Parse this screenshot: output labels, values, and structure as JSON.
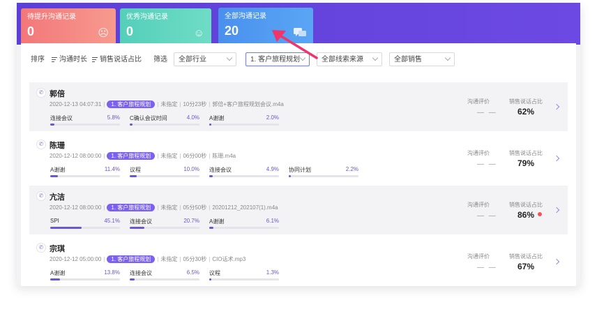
{
  "stats": [
    {
      "label": "待提升沟通记录",
      "value": "0",
      "deco": "⌒"
    },
    {
      "label": "优秀沟通记录",
      "value": "0",
      "deco": "◡"
    },
    {
      "label": "全部沟通记录",
      "value": "20",
      "deco": "▰"
    }
  ],
  "filter": {
    "sort_label": "排序",
    "sort_duration": "沟通时长",
    "sort_ratio": "销售说话占比",
    "filter_label": "筛选",
    "industry": "全部行业",
    "journey": "1. 客户旅程规划",
    "source": "全部线索来源",
    "sales": "全部销售"
  },
  "columns": {
    "eval": "沟通评价",
    "ratio": "销售说话占比"
  },
  "records": [
    {
      "name": "郭倍",
      "time": "2020-12-13 04:07:31",
      "tag": "1. 客户旅程规划",
      "assign": "未指定",
      "duration": "10分23秒",
      "file": "郭倍+客户旅程规划会议.m4a",
      "keywords": [
        {
          "label": "连接会议",
          "value": "5.8%",
          "pct": 5.8
        },
        {
          "label": "C确认会议时间",
          "value": "4.0%",
          "pct": 4.0
        },
        {
          "label": "A谢谢",
          "value": "2.0%",
          "pct": 2.0
        }
      ],
      "eval": "— —",
      "ratio": "62%",
      "alert": false
    },
    {
      "name": "陈珊",
      "time": "2020-12-12 08:00:00",
      "tag": "1. 客户旅程规划",
      "assign": "未指定",
      "duration": "06分00秒",
      "file": "陈珊.m4a",
      "keywords": [
        {
          "label": "A谢谢",
          "value": "11.4%",
          "pct": 11.4
        },
        {
          "label": "议程",
          "value": "10.0%",
          "pct": 10.0
        },
        {
          "label": "连接会议",
          "value": "4.9%",
          "pct": 4.9
        },
        {
          "label": "协同计划",
          "value": "2.2%",
          "pct": 2.2
        }
      ],
      "eval": "— —",
      "ratio": "79%",
      "alert": false
    },
    {
      "name": "亢洁",
      "time": "2020-12-12 08:00:00",
      "tag": "1. 客户旅程规划",
      "assign": "未指定",
      "duration": "05分50秒",
      "file": "20201212_202107(1).m4a",
      "keywords": [
        {
          "label": "SPI",
          "value": "45.1%",
          "pct": 45.1
        },
        {
          "label": "连接会议",
          "value": "20.7%",
          "pct": 20.7
        },
        {
          "label": "A谢谢",
          "value": "6.1%",
          "pct": 6.1
        }
      ],
      "eval": "— —",
      "ratio": "86%",
      "alert": true
    },
    {
      "name": "宗琪",
      "time": "2020-12-12 05:00:00",
      "tag": "1. 客户旅程规划",
      "assign": "未指定",
      "duration": "05分30秒",
      "file": "CIO话术.mp3",
      "keywords": [
        {
          "label": "A谢谢",
          "value": "13.8%",
          "pct": 13.8
        },
        {
          "label": "连接会议",
          "value": "6.5%",
          "pct": 6.5
        },
        {
          "label": "议程",
          "value": "1.3%",
          "pct": 1.3
        }
      ],
      "eval": "— —",
      "ratio": "67%",
      "alert": false
    }
  ]
}
